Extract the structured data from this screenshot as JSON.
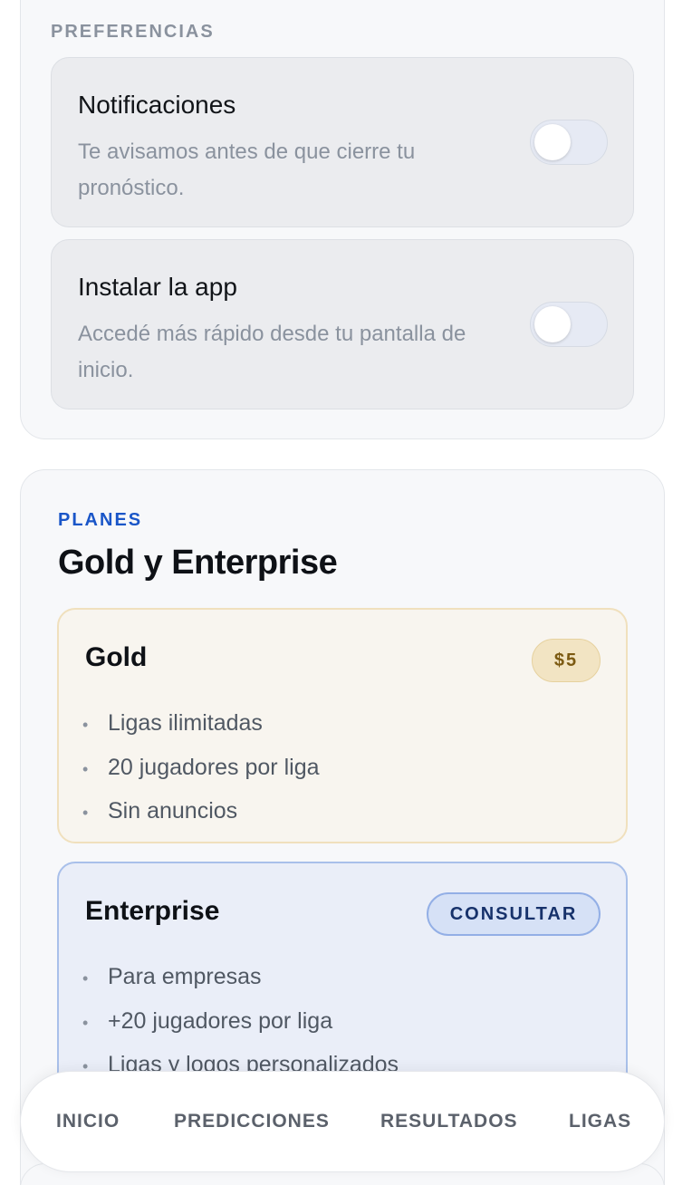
{
  "preferences": {
    "section_label": "PREFERENCIAS",
    "items": [
      {
        "title": "Notificaciones",
        "description": "Te avisamos antes de que cierre tu pronóstico.",
        "enabled": false
      },
      {
        "title": "Instalar la app",
        "description": "Accedé más rápido desde tu pantalla de inicio.",
        "enabled": false
      }
    ]
  },
  "plans": {
    "eyebrow": "PLANES",
    "title": "Gold y Enterprise",
    "items": [
      {
        "name": "Gold",
        "badge": "$5",
        "features": [
          "Ligas ilimitadas",
          "20 jugadores por liga",
          "Sin anuncios"
        ]
      },
      {
        "name": "Enterprise",
        "badge": "CONSULTAR",
        "features": [
          "Para empresas",
          "+20 jugadores por liga",
          "Ligas y logos personalizados"
        ]
      }
    ]
  },
  "bottom_nav": {
    "items": [
      {
        "label": "INICIO"
      },
      {
        "label": "PREDICCIONES"
      },
      {
        "label": "RESULTADOS"
      },
      {
        "label": "LIGAS"
      }
    ]
  },
  "colors": {
    "accent": "#1a56c8",
    "gold_badge": "#f2e4c3",
    "enterprise_badge": "#d6e1f6"
  }
}
